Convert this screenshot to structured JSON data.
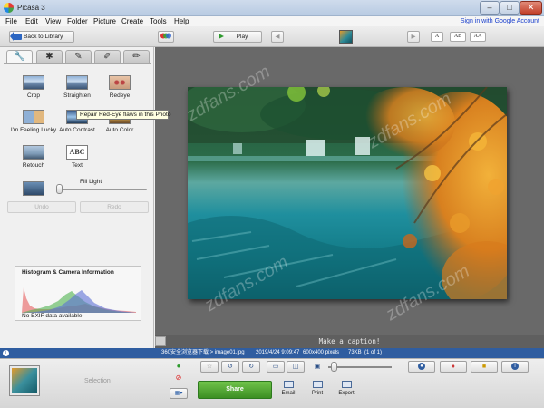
{
  "window": {
    "title": "Picasa 3",
    "minimize": "–",
    "maximize": "□",
    "close": "✕"
  },
  "menu": {
    "items": [
      {
        "label": "File"
      },
      {
        "label": "Edit"
      },
      {
        "label": "View"
      },
      {
        "label": "Folder"
      },
      {
        "label": "Picture"
      },
      {
        "label": "Create"
      },
      {
        "label": "Tools"
      },
      {
        "label": "Help"
      }
    ],
    "signin": "Sign in with Google Account"
  },
  "toolbar": {
    "back_label": "Back to Library",
    "play_label": "Play",
    "prev_glyph": "◀",
    "next_glyph": "▶",
    "text_size_buttons": [
      "A",
      "AB",
      "AA"
    ]
  },
  "edit_panel": {
    "tabs": [
      {
        "icon": "wrench-icon",
        "glyph": "🔧"
      },
      {
        "icon": "sparkle-icon",
        "glyph": "✱"
      },
      {
        "icon": "brush-icon",
        "glyph": "✎"
      },
      {
        "icon": "palette-brush-icon",
        "glyph": "✐"
      },
      {
        "icon": "filter-brush-icon",
        "glyph": "✏"
      }
    ],
    "tools": [
      {
        "label": "Crop"
      },
      {
        "label": "Straighten"
      },
      {
        "label": "Redeye"
      },
      {
        "label": "I'm Feeling Lucky"
      },
      {
        "label": "Auto Contrast"
      },
      {
        "label": "Auto Color"
      },
      {
        "label": "Retouch"
      },
      {
        "label": "Text"
      }
    ],
    "text_thumb": "ABC",
    "tooltip": "Repair Red-Eye flaws in this Photo",
    "fill_light_label": "Fill Light",
    "fill_light_level": 0,
    "undo_label": "Undo",
    "redo_label": "Redo",
    "histogram_title": "Histogram & Camera Information",
    "exif_text": "No EXIF data available"
  },
  "viewer": {
    "caption_placeholder": "Make a caption!",
    "watermark": "zdfans.com"
  },
  "status": {
    "path": "360安全浏览器下载 > image01.jpg",
    "datetime": "2019/4/24 9:09:47",
    "dimensions": "600x400 pixels",
    "filesize": "73KB",
    "position": "(1 of 1)"
  },
  "tray": {
    "selection_label": "Selection",
    "share_label": "Share",
    "email_label": "Email",
    "print_label": "Print",
    "export_label": "Export",
    "zoom_level": 0.05
  },
  "colors": {
    "accent": "#2f5da0",
    "share_green": "#4aa32a",
    "photo_bg": "#696969"
  }
}
